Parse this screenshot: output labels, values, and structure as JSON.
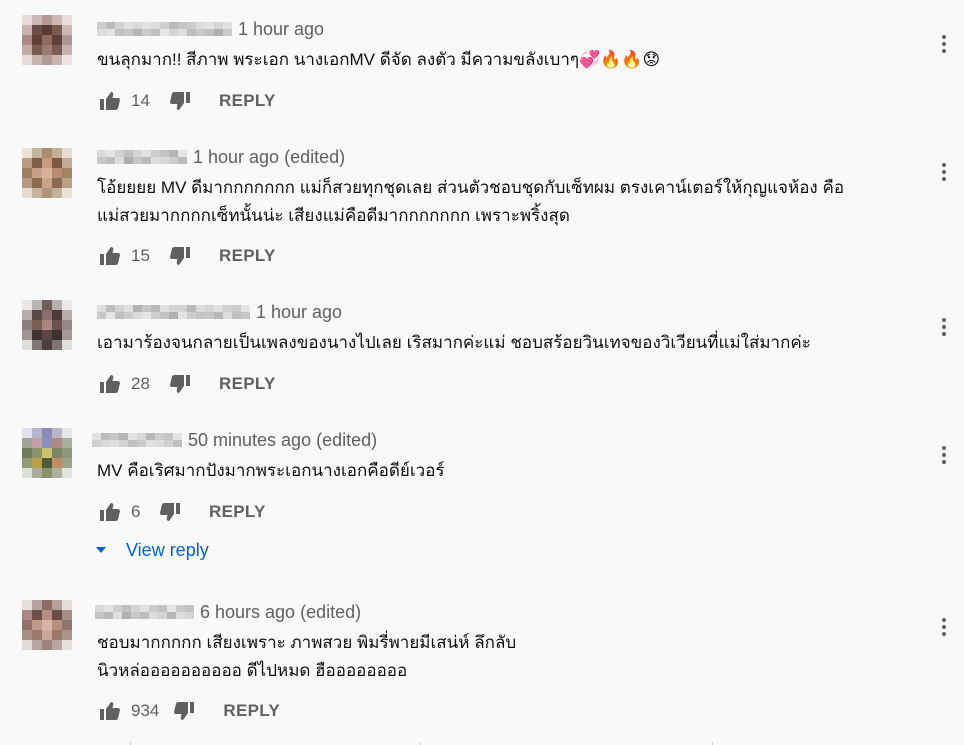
{
  "comments": [
    {
      "time": "1 hour ago",
      "text_lines": [
        "ขนลุกมาก!! สีภาพ พระเอก นางเอกMV ดีจัด ลงตัว มีความขลังเบาๆ💞🔥🔥😟"
      ],
      "likes": "14",
      "reply_label": "REPLY"
    },
    {
      "time": "1 hour ago (edited)",
      "text_lines": [
        "โอ้ยยยย MV ดีมากกกกกกก แม่ก็สวยทุกชุดเลย ส่วนตัวชอบชุดกับเซ็ทผม ตรงเคาน์เตอร์ให้กุญแจห้อง  คือ",
        "แม่สวยมากกกกเซ็ทนั้นน่ะ เสียงแม่คือดีมากกกกกกก เพราะพริ้งสุด"
      ],
      "likes": "15",
      "reply_label": "REPLY"
    },
    {
      "time": "1 hour ago",
      "text_lines": [
        "เอามาร้องจนกลายเป็นเพลงของนางไปเลย เริสมากค่ะแม่ ชอบสร้อยวินเทจของวิเวียนที่แม่ใส่มากค่ะ"
      ],
      "likes": "28",
      "reply_label": "REPLY"
    },
    {
      "time": "50 minutes ago (edited)",
      "text_lines": [
        "MV คือเริศมากปังมากพระเอกนางเอกคือดีย์เวอร์"
      ],
      "likes": "6",
      "reply_label": "REPLY"
    },
    {
      "time": "6 hours ago (edited)",
      "text_lines": [
        "ชอบมากกกกก เสียงเพราะ ภาพสวย พิมรี่พายมีเสน่ห์ ลึกลับ",
        "นิวหล่ออออออออออ ดีไปหมด ฮืออออออออ"
      ],
      "likes": "934",
      "reply_label": "REPLY"
    }
  ],
  "view_reply": "View reply",
  "colors": {
    "background": "#f9f9f9",
    "meta_gray": "#606060",
    "link_blue": "#065fd4",
    "text": "#0f0f0f"
  },
  "icons": {
    "like": "thumbs-up-icon",
    "dislike": "thumbs-down-icon",
    "menu": "kebab-menu-icon",
    "expand": "caret-down-icon"
  }
}
